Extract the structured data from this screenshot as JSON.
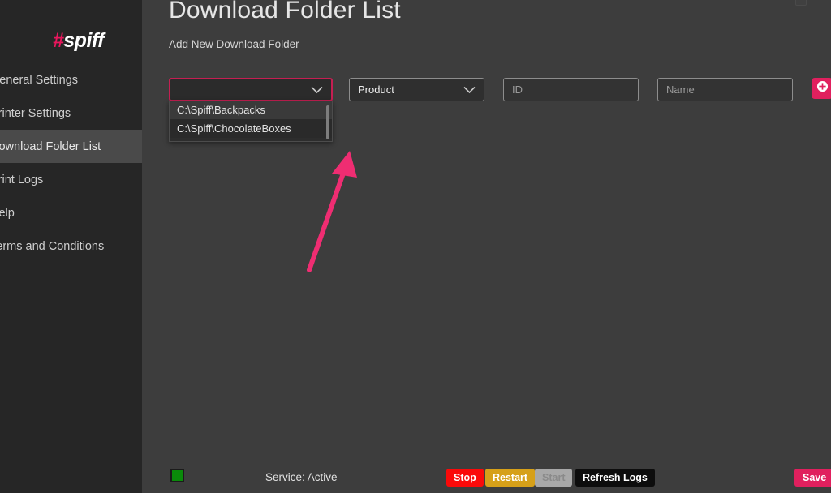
{
  "sidebar": {
    "logo": {
      "hash": "#",
      "word": "spiff"
    },
    "items": [
      {
        "label": "General Settings",
        "active": false
      },
      {
        "label": "Printer Settings",
        "active": false
      },
      {
        "label": "Download Folder List",
        "active": true
      },
      {
        "label": "Print Logs",
        "active": false
      },
      {
        "label": "Help",
        "active": false
      },
      {
        "label": "Terms and Conditions",
        "active": false
      }
    ]
  },
  "main": {
    "title": "Download Folder List",
    "subtitle": "Add New Download Folder",
    "form": {
      "folder_select": {
        "value": "",
        "placeholder": "",
        "expanded": true,
        "options": [
          "C:\\Spiff\\Backpacks",
          "C:\\Spiff\\ChocolateBoxes"
        ],
        "hovered_index": 1
      },
      "product_select": {
        "value": "Product"
      },
      "id_input": {
        "value": "",
        "placeholder": "ID"
      },
      "name_input": {
        "value": "",
        "placeholder": "Name"
      },
      "add_button_icon": "plus-circle-icon"
    }
  },
  "bottom_bar": {
    "status_text": "Service: Active",
    "status_color": "#0a8a0a",
    "buttons": {
      "stop": "Stop",
      "restart": "Restart",
      "start": "Start",
      "refresh_logs": "Refresh Logs",
      "save": "Save"
    }
  },
  "colors": {
    "accent_pink": "#e0205e",
    "focus_border": "#c51f52",
    "sidebar_bg": "#262626",
    "main_bg": "#3d3d3d",
    "stop_red": "#fa0a0a",
    "restart_amber": "#d6a019",
    "start_disabled": "#a8a8a8",
    "refresh_black": "#0d0d0d",
    "status_green": "#0a8a0a"
  },
  "annotation": {
    "arrow_color": "#ef2d72",
    "icon": "arrow-up-right-icon"
  }
}
